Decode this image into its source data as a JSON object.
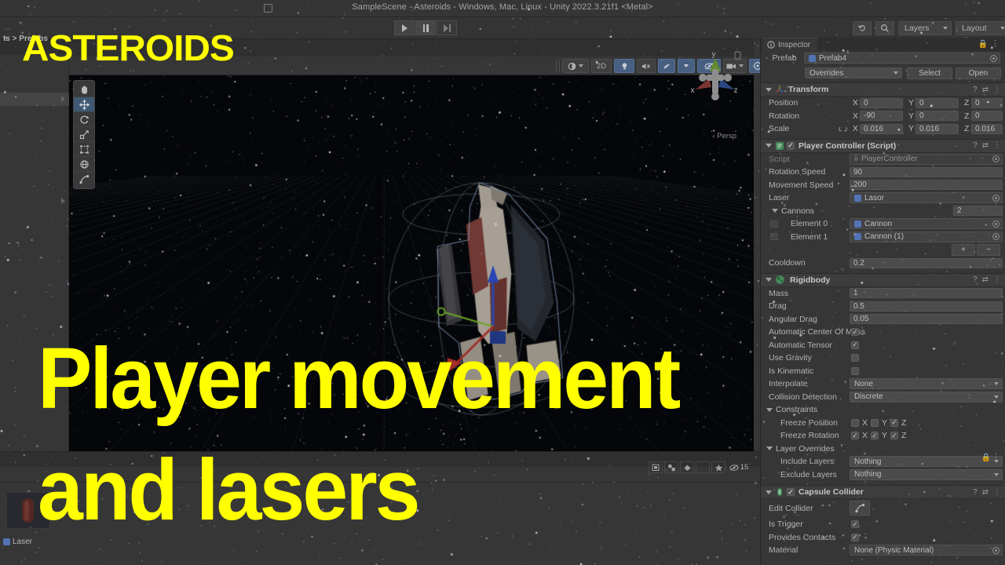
{
  "window": {
    "title": "SampleScene - Asteroids - Windows, Mac, Linux - Unity 2022.3.21f1 <Metal>",
    "play_label": "play-icon",
    "pause_label": "pause-icon",
    "step_label": "step-icon"
  },
  "toolbar": {
    "history_icon": "undo-history-icon",
    "search_icon": "search-icon",
    "layers": "Layers",
    "layout": "Layout"
  },
  "scene_toolbar": {
    "shading": "shading-mode-icon",
    "mode_2d": "2D",
    "lighting": "lighting-icon",
    "audio": "audio-mute-icon",
    "fx": "effects-icon",
    "camera": "scene-camera-icon",
    "gizmos": "gizmos-icon"
  },
  "tools": [
    {
      "name": "hand-tool",
      "active": false
    },
    {
      "name": "move-tool",
      "active": true
    },
    {
      "name": "rotate-tool",
      "active": false
    },
    {
      "name": "scale-tool",
      "active": false
    },
    {
      "name": "rect-tool",
      "active": false
    },
    {
      "name": "transform-tool",
      "active": false
    },
    {
      "name": "custom-editor-tool",
      "active": false
    }
  ],
  "gizmo": {
    "x": "x",
    "y": "y",
    "z": "z",
    "persp": "Persp"
  },
  "inspector": {
    "tab": "Inspector",
    "prefab_label": "Prefab",
    "prefab_name": "Prefab4",
    "overrides": "Overrides",
    "select": "Select",
    "open": "Open",
    "transform": {
      "title": "Transform",
      "rows": [
        {
          "label": "Position",
          "x": "0",
          "y": "0",
          "z": "0"
        },
        {
          "label": "Rotation",
          "x": "-90",
          "y": "0",
          "z": "0"
        },
        {
          "label": "Scale",
          "x": "0.016",
          "y": "0.016",
          "z": "0.016"
        }
      ],
      "axis_x": "X",
      "axis_y": "Y",
      "axis_z": "Z"
    },
    "player_controller": {
      "title": "Player Controller (Script)",
      "script_label": "Script",
      "script_value": "PlayerController",
      "rotation_speed_label": "Rotation Speed",
      "rotation_speed": "90",
      "movement_speed_label": "Movement Speed",
      "movement_speed": "200",
      "laser_label": "Laser",
      "laser_value": "Lasor",
      "cannons_label": "Cannons",
      "cannons_count": "2",
      "element0_label": "Element 0",
      "element0_value": "Cannon",
      "element1_label": "Element 1",
      "element1_value": "Cannon (1)",
      "add_btn": "+",
      "remove_btn": "−",
      "cooldown_label": "Cooldown",
      "cooldown": "0.2"
    },
    "rigidbody": {
      "title": "Rigidbody",
      "mass_label": "Mass",
      "mass": "1",
      "drag_label": "Drag",
      "drag": "0.5",
      "angular_drag_label": "Angular Drag",
      "angular_drag": "0.05",
      "auto_center_label": "Automatic Center Of Mass",
      "auto_center": true,
      "auto_tensor_label": "Automatic Tensor",
      "auto_tensor": true,
      "use_gravity_label": "Use Gravity",
      "use_gravity": false,
      "is_kinematic_label": "Is Kinematic",
      "is_kinematic": false,
      "interpolate_label": "Interpolate",
      "interpolate": "None",
      "collision_detection_label": "Collision Detection",
      "collision_detection": "Discrete",
      "constraints_label": "Constraints",
      "freeze_position_label": "Freeze Position",
      "freeze_position": {
        "x": false,
        "y": false,
        "z": true
      },
      "freeze_rotation_label": "Freeze Rotation",
      "freeze_rotation": {
        "x": true,
        "y": true,
        "z": true
      },
      "layer_overrides_label": "Layer Overrides",
      "include_layers_label": "Include Layers",
      "include_layers": "Nothing",
      "exclude_layers_label": "Exclude Layers",
      "exclude_layers": "Nothing",
      "axis_x": "X",
      "axis_y": "Y",
      "axis_z": "Z"
    },
    "capsule_collider": {
      "title": "Capsule Collider",
      "edit_collider_label": "Edit Collider",
      "is_trigger_label": "Is Trigger",
      "is_trigger": true,
      "provides_contacts_label": "Provides Contacts",
      "provides_contacts": true,
      "material_label": "Material",
      "material": "None (Physic Material)"
    }
  },
  "project": {
    "breadcrumb": "ts > Prefabs",
    "asset_name": "Laser",
    "count": "15"
  },
  "overlay": {
    "title": "ASTEROIDS",
    "line1": "Player movement",
    "line2": "and lasers",
    "color": "#ffff00"
  }
}
